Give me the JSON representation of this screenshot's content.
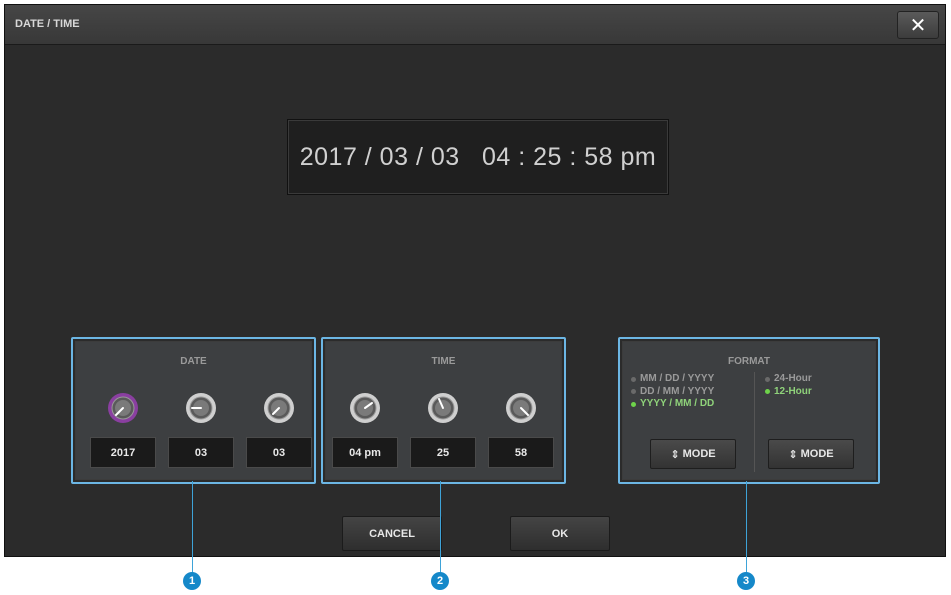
{
  "window": {
    "title": "DATE / TIME",
    "close_label": "✕"
  },
  "display": {
    "date": "2017 / 03 / 03",
    "time": "04 : 25 : 58 pm"
  },
  "date_panel": {
    "label": "DATE",
    "year": "2017",
    "month": "03",
    "day": "03",
    "knob_colors": {
      "active": "#8a3fa0",
      "inactive": "#cfcfcf"
    }
  },
  "time_panel": {
    "label": "TIME",
    "hour": "04 pm",
    "minute": "25",
    "second": "58"
  },
  "format_panel": {
    "label": "FORMAT",
    "date_formats": [
      "MM / DD / YYYY",
      "DD / MM / YYYY",
      "YYYY / MM / DD"
    ],
    "selected_date_format": "YYYY / MM / DD",
    "hour_formats": [
      "24-Hour",
      "12-Hour"
    ],
    "selected_hour_format": "12-Hour",
    "mode_label": "MODE",
    "mode_icon": "up-down-arrows-icon"
  },
  "actions": {
    "cancel_label": "CANCEL",
    "ok_label": "OK"
  },
  "callouts": [
    "1",
    "2",
    "3"
  ],
  "colors": {
    "highlight": "#6cb6e4",
    "callout": "#1588c9",
    "selected_dot": "#6ed34a"
  }
}
